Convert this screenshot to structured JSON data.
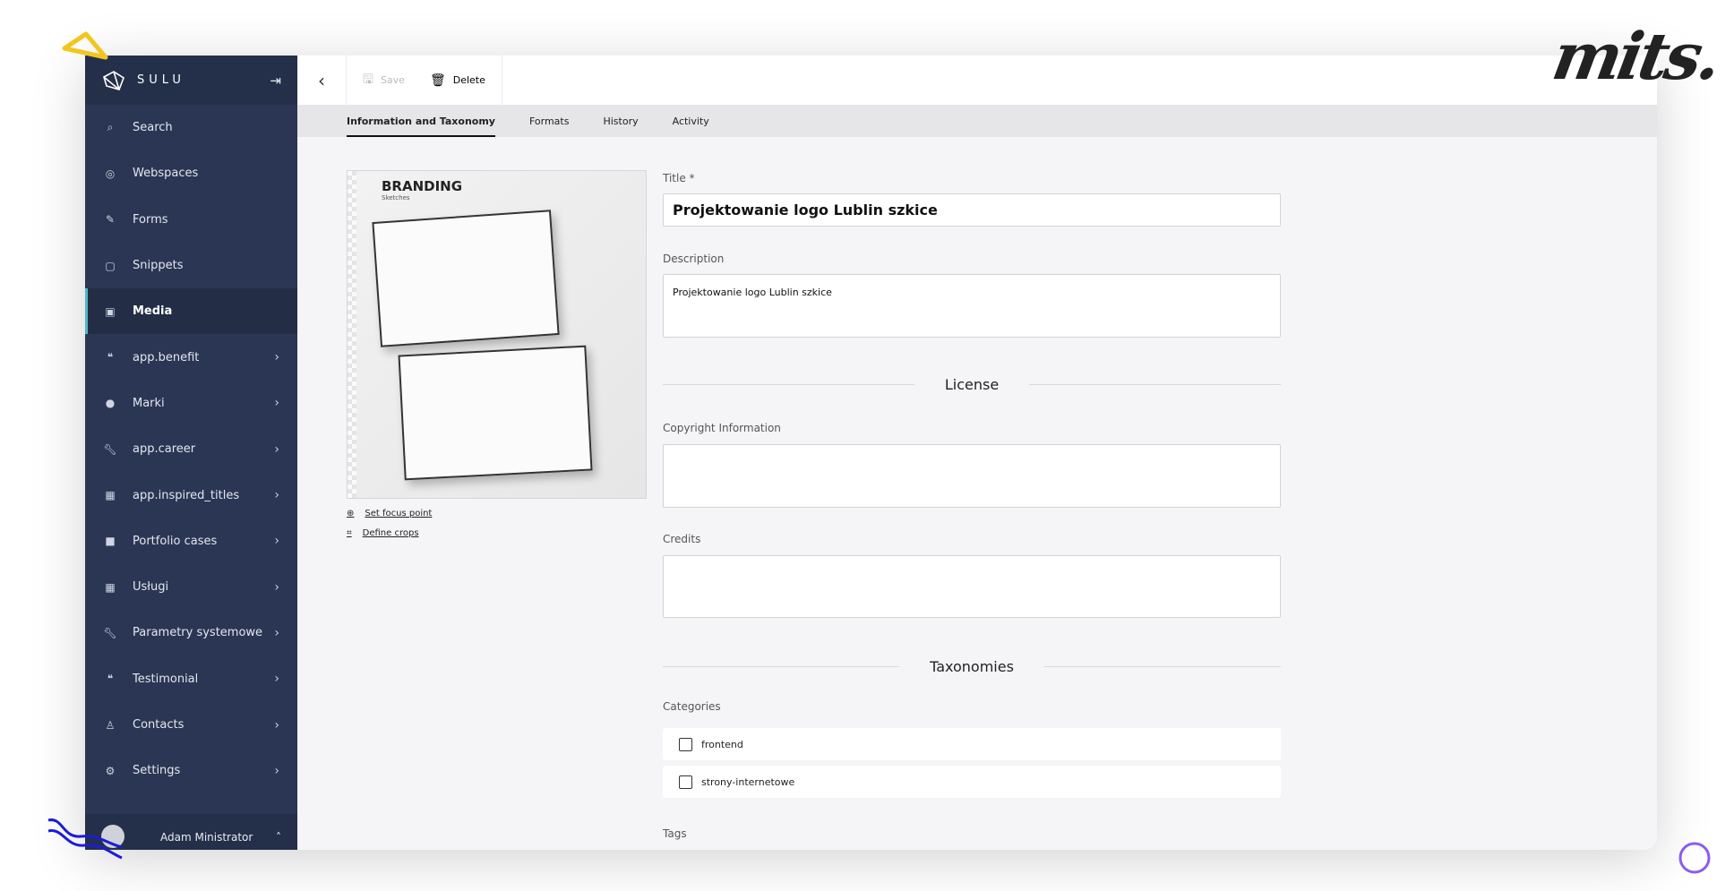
{
  "sidebar": {
    "brand": "SULU",
    "items": [
      {
        "label": "Search",
        "icon": "search-icon"
      },
      {
        "label": "Webspaces",
        "icon": "target-icon"
      },
      {
        "label": "Forms",
        "icon": "pencil-icon"
      },
      {
        "label": "Snippets",
        "icon": "note-icon"
      },
      {
        "label": "Media",
        "icon": "image-icon",
        "active": true
      },
      {
        "label": "app.benefit",
        "icon": "quote-icon"
      },
      {
        "label": "Marki",
        "icon": "compass-icon"
      },
      {
        "label": "app.career",
        "icon": "wrench-icon"
      },
      {
        "label": "app.inspired_titles",
        "icon": "calendar-icon"
      },
      {
        "label": "Portfolio cases",
        "icon": "briefcase-icon"
      },
      {
        "label": "Usługi",
        "icon": "calendar-icon"
      },
      {
        "label": "Parametry systemowe",
        "icon": "wrench-icon"
      },
      {
        "label": "Testimonial",
        "icon": "quote-icon"
      },
      {
        "label": "Contacts",
        "icon": "user-icon"
      },
      {
        "label": "Settings",
        "icon": "gear-icon"
      }
    ],
    "user": "Adam Ministrator"
  },
  "toolbar": {
    "save": "Save",
    "delete": "Delete"
  },
  "tabs": [
    "Information and Taxonomy",
    "Formats",
    "History",
    "Activity"
  ],
  "media": {
    "image_title": "BRANDING",
    "image_subtitle": "Sketches",
    "focus_link": "Set focus point",
    "crops_link": "Define crops"
  },
  "form": {
    "title_label": "Title *",
    "title_value": "Projektowanie logo Lublin szkice",
    "description_label": "Description",
    "description_value": "Projektowanie logo Lublin szkice",
    "license_heading": "License",
    "copyright_label": "Copyright Information",
    "copyright_value": "",
    "credits_label": "Credits",
    "credits_value": "",
    "taxonomies_heading": "Taxonomies",
    "categories_label": "Categories",
    "categories": [
      {
        "label": "frontend",
        "checked": false
      },
      {
        "label": "strony-internetowe",
        "checked": false
      }
    ],
    "tags_label": "Tags"
  },
  "overlay": {
    "logo_text": "mits."
  },
  "colors": {
    "sidebar": "#2b3654",
    "active_accent": "#52b6ca",
    "decor_yellow": "#f2c61f",
    "decor_blue": "#1d1bd6",
    "decor_purple": "#8a5cf0"
  }
}
